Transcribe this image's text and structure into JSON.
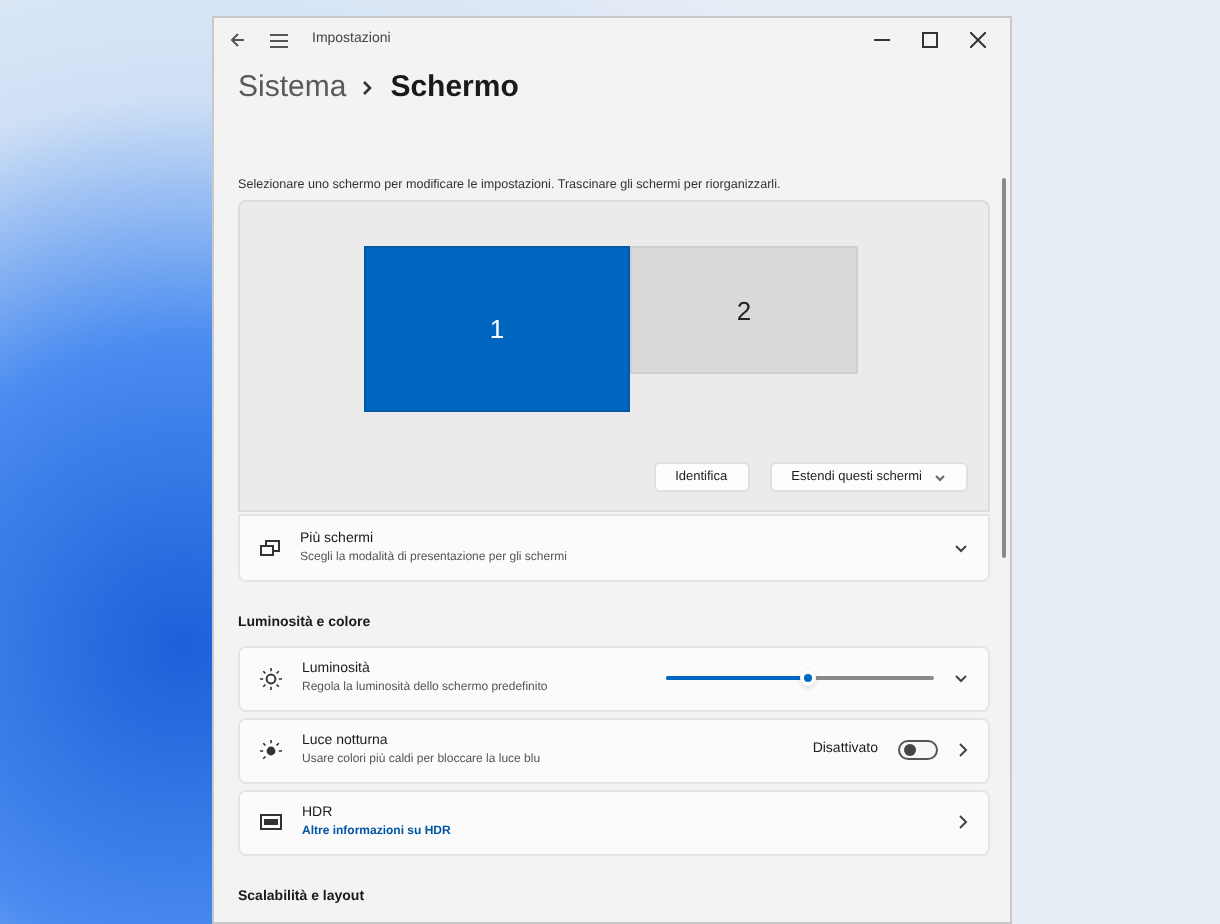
{
  "window": {
    "title": "Impostazioni"
  },
  "breadcrumb": [
    "Sistema",
    "Schermo"
  ],
  "description": "Selezionare uno schermo per modificare le impostazioni. Trascinare gli schermi per riorganizzarli.",
  "displays": [
    {
      "label": "1",
      "selected": true
    },
    {
      "label": "2",
      "selected": false
    }
  ],
  "display_buttons": [
    {
      "label": "Identifica",
      "kind": "button"
    },
    {
      "label": "Estendi questi schermi",
      "kind": "dropdown"
    }
  ],
  "multiple_displays": {
    "title": "Più schermi",
    "subtitle": "Scegli la modalità di presentazione per gli schermi",
    "expanded": false
  },
  "sections": [
    {
      "heading": "Luminosità e colore",
      "items": [
        {
          "kind": "slider",
          "title": "Luminosità",
          "subtitle": "Regola la luminosità dello schermo predefinito",
          "level": 0.53
        },
        {
          "kind": "toggle",
          "title": "Luce notturna",
          "subtitle": "Usare colori più caldi per bloccare la luce blu",
          "status": "Disattivato",
          "on": false
        },
        {
          "kind": "link",
          "title": "HDR",
          "link": "Altre informazioni su HDR"
        }
      ]
    },
    {
      "heading": "Scalabilità e layout"
    }
  ]
}
